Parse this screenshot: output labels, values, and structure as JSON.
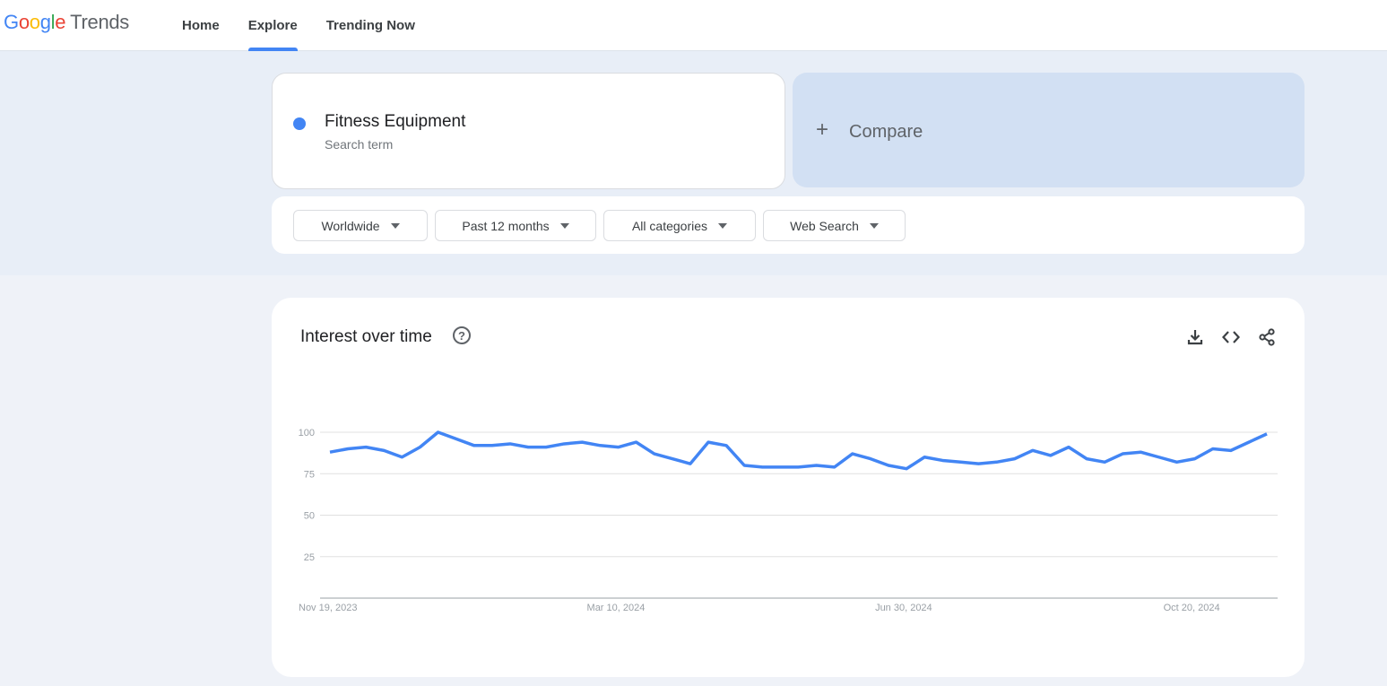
{
  "header": {
    "logo_letters": [
      "G",
      "o",
      "o",
      "g",
      "l",
      "e"
    ],
    "logo_product": "Trends",
    "nav": [
      {
        "label": "Home",
        "active": false
      },
      {
        "label": "Explore",
        "active": true
      },
      {
        "label": "Trending Now",
        "active": false
      }
    ]
  },
  "search": {
    "term": "Fitness Equipment",
    "term_type": "Search term",
    "term_color": "#4285f4",
    "compare_icon": "plus-icon",
    "compare_label": "Compare"
  },
  "filters": [
    {
      "label": "Worldwide"
    },
    {
      "label": "Past 12 months"
    },
    {
      "label": "All categories"
    },
    {
      "label": "Web Search"
    }
  ],
  "card": {
    "title": "Interest over time",
    "help_icon": "?",
    "actions": [
      "download-icon",
      "embed-code-icon",
      "share-icon"
    ]
  },
  "chart_data": {
    "type": "line",
    "title": "Interest over time",
    "xlabel": "",
    "ylabel": "",
    "ylim": [
      0,
      100
    ],
    "yticks": [
      25,
      50,
      75,
      100
    ],
    "xtick_labels": [
      "Nov 19, 2023",
      "Mar 10, 2024",
      "Jun 30, 2024",
      "Oct 20, 2024"
    ],
    "xtick_indices": [
      0,
      16,
      32,
      48
    ],
    "grid": true,
    "legend": "none",
    "series": [
      {
        "name": "Fitness Equipment",
        "color": "#4285f4",
        "values": [
          88,
          90,
          91,
          89,
          85,
          91,
          100,
          96,
          92,
          92,
          93,
          91,
          91,
          93,
          94,
          92,
          91,
          94,
          87,
          84,
          81,
          94,
          92,
          80,
          79,
          79,
          79,
          80,
          79,
          87,
          84,
          80,
          78,
          85,
          83,
          82,
          81,
          82,
          84,
          89,
          86,
          91,
          84,
          82,
          87,
          88,
          85,
          82,
          84,
          90,
          89,
          94,
          99
        ]
      }
    ]
  }
}
